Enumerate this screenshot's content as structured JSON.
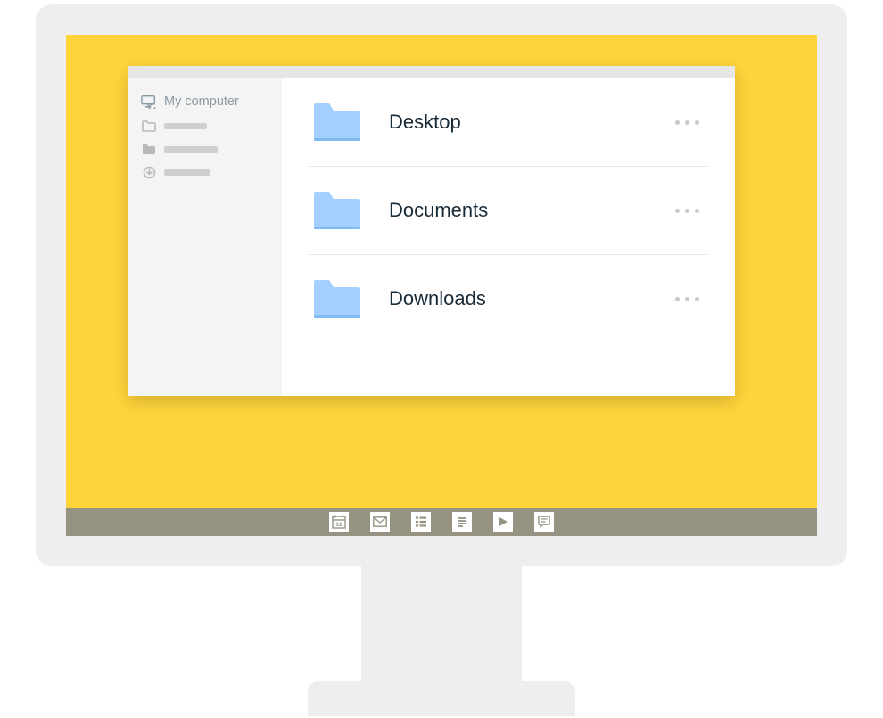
{
  "sidebar": {
    "items": [
      {
        "label": "My computer",
        "icon": "computer-sync-icon",
        "active": true
      },
      {
        "label": "",
        "icon": "folder-outline-icon",
        "active": false
      },
      {
        "label": "",
        "icon": "folder-solid-icon",
        "active": false
      },
      {
        "label": "",
        "icon": "download-circle-icon",
        "active": false
      }
    ]
  },
  "content": {
    "folders": [
      {
        "name": "Desktop"
      },
      {
        "name": "Documents"
      },
      {
        "name": "Downloads"
      }
    ]
  },
  "taskbar": {
    "icons": [
      "calendar-icon",
      "mail-icon",
      "list-icon",
      "document-icon",
      "play-icon",
      "chat-icon"
    ]
  },
  "colors": {
    "screen": "#ffd43b",
    "folder": "#a3d0ff",
    "folder_shadow": "#7fbaf0",
    "monitor": "#eeeeee",
    "taskbar": "#969382"
  }
}
